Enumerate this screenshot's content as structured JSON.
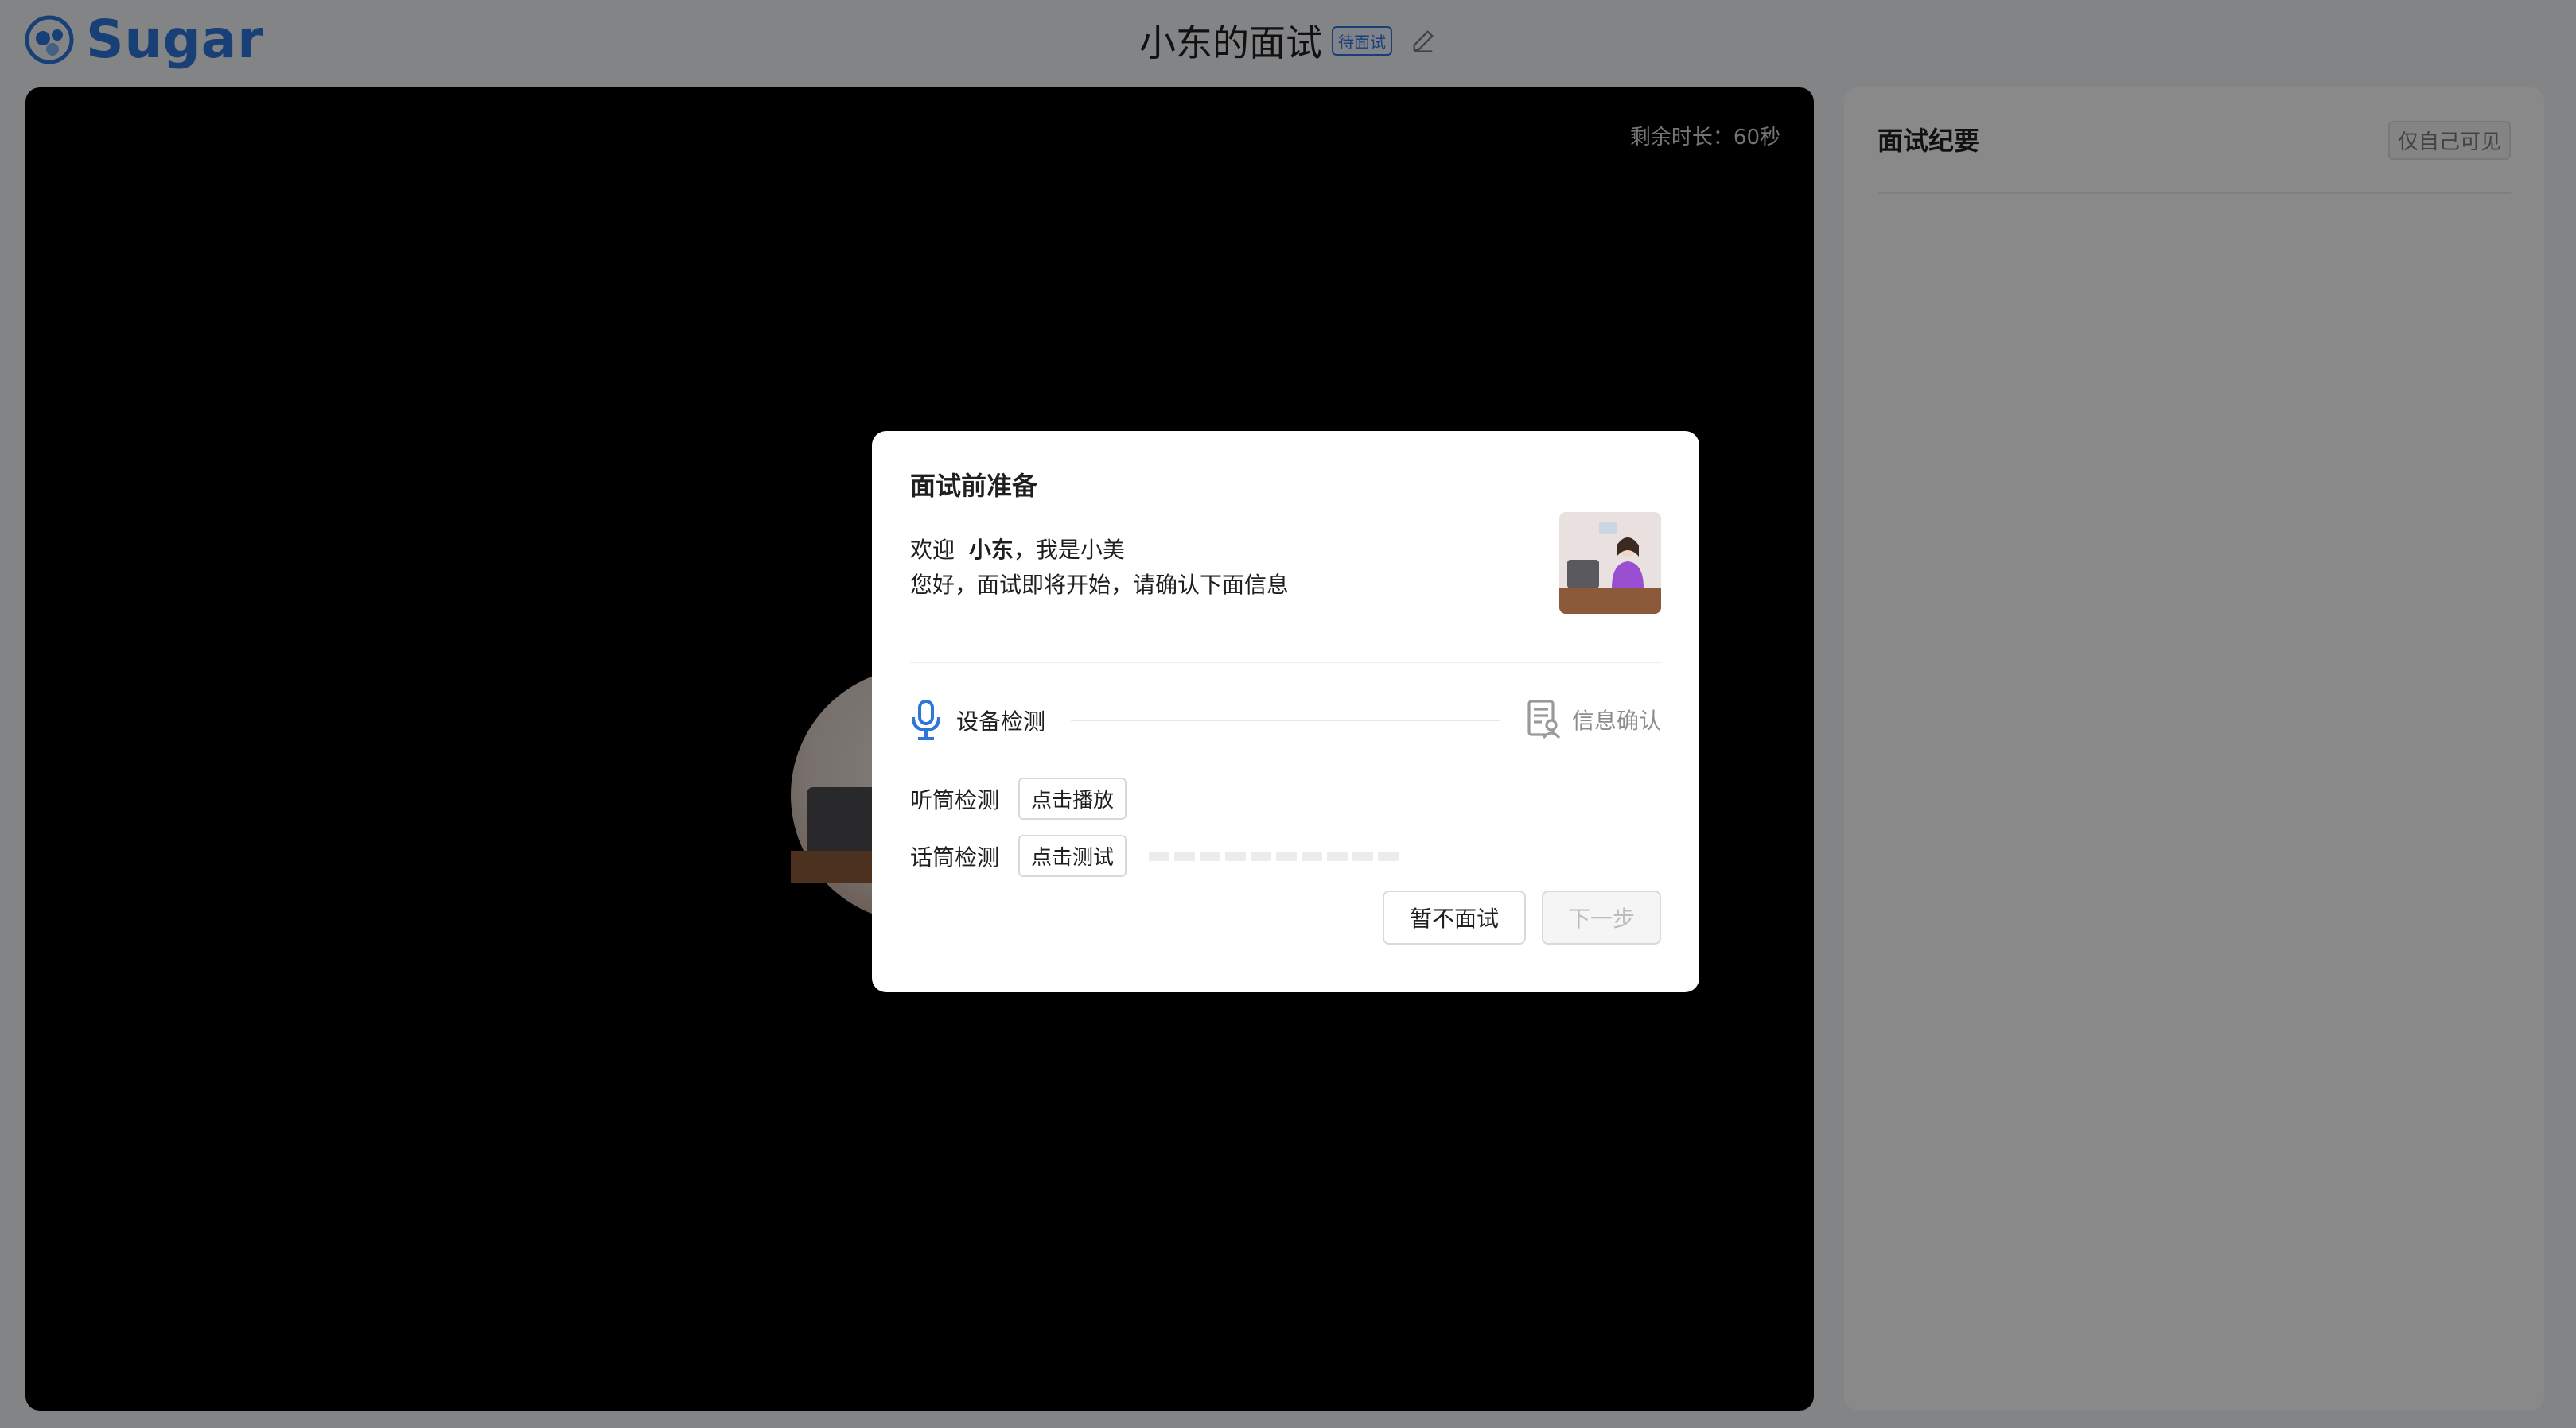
{
  "header": {
    "logo_text": "Sugar",
    "title": "小东的面试",
    "status_badge": "待面试"
  },
  "video": {
    "timer_text": "剩余时长：60秒"
  },
  "notes_panel": {
    "title": "面试纪要",
    "visibility_tag": "仅自己可见"
  },
  "modal": {
    "title": "面试前准备",
    "welcome_prefix": "欢迎",
    "candidate_name": "小东",
    "welcome_suffix": "，我是小美",
    "intro": "您好，面试即将开始，请确认下面信息",
    "steps": {
      "device_check": "设备检测",
      "info_confirm": "信息确认"
    },
    "speaker_check": {
      "label": "听筒检测",
      "button": "点击播放"
    },
    "mic_check": {
      "label": "话筒检测",
      "button": "点击测试",
      "level_segments": 10
    },
    "cancel_button": "暂不面试",
    "next_button": "下一步"
  },
  "colors": {
    "accent": "#2f76d8",
    "video_bg": "#000000",
    "overlay": "rgba(0,0,0,0.45)"
  }
}
